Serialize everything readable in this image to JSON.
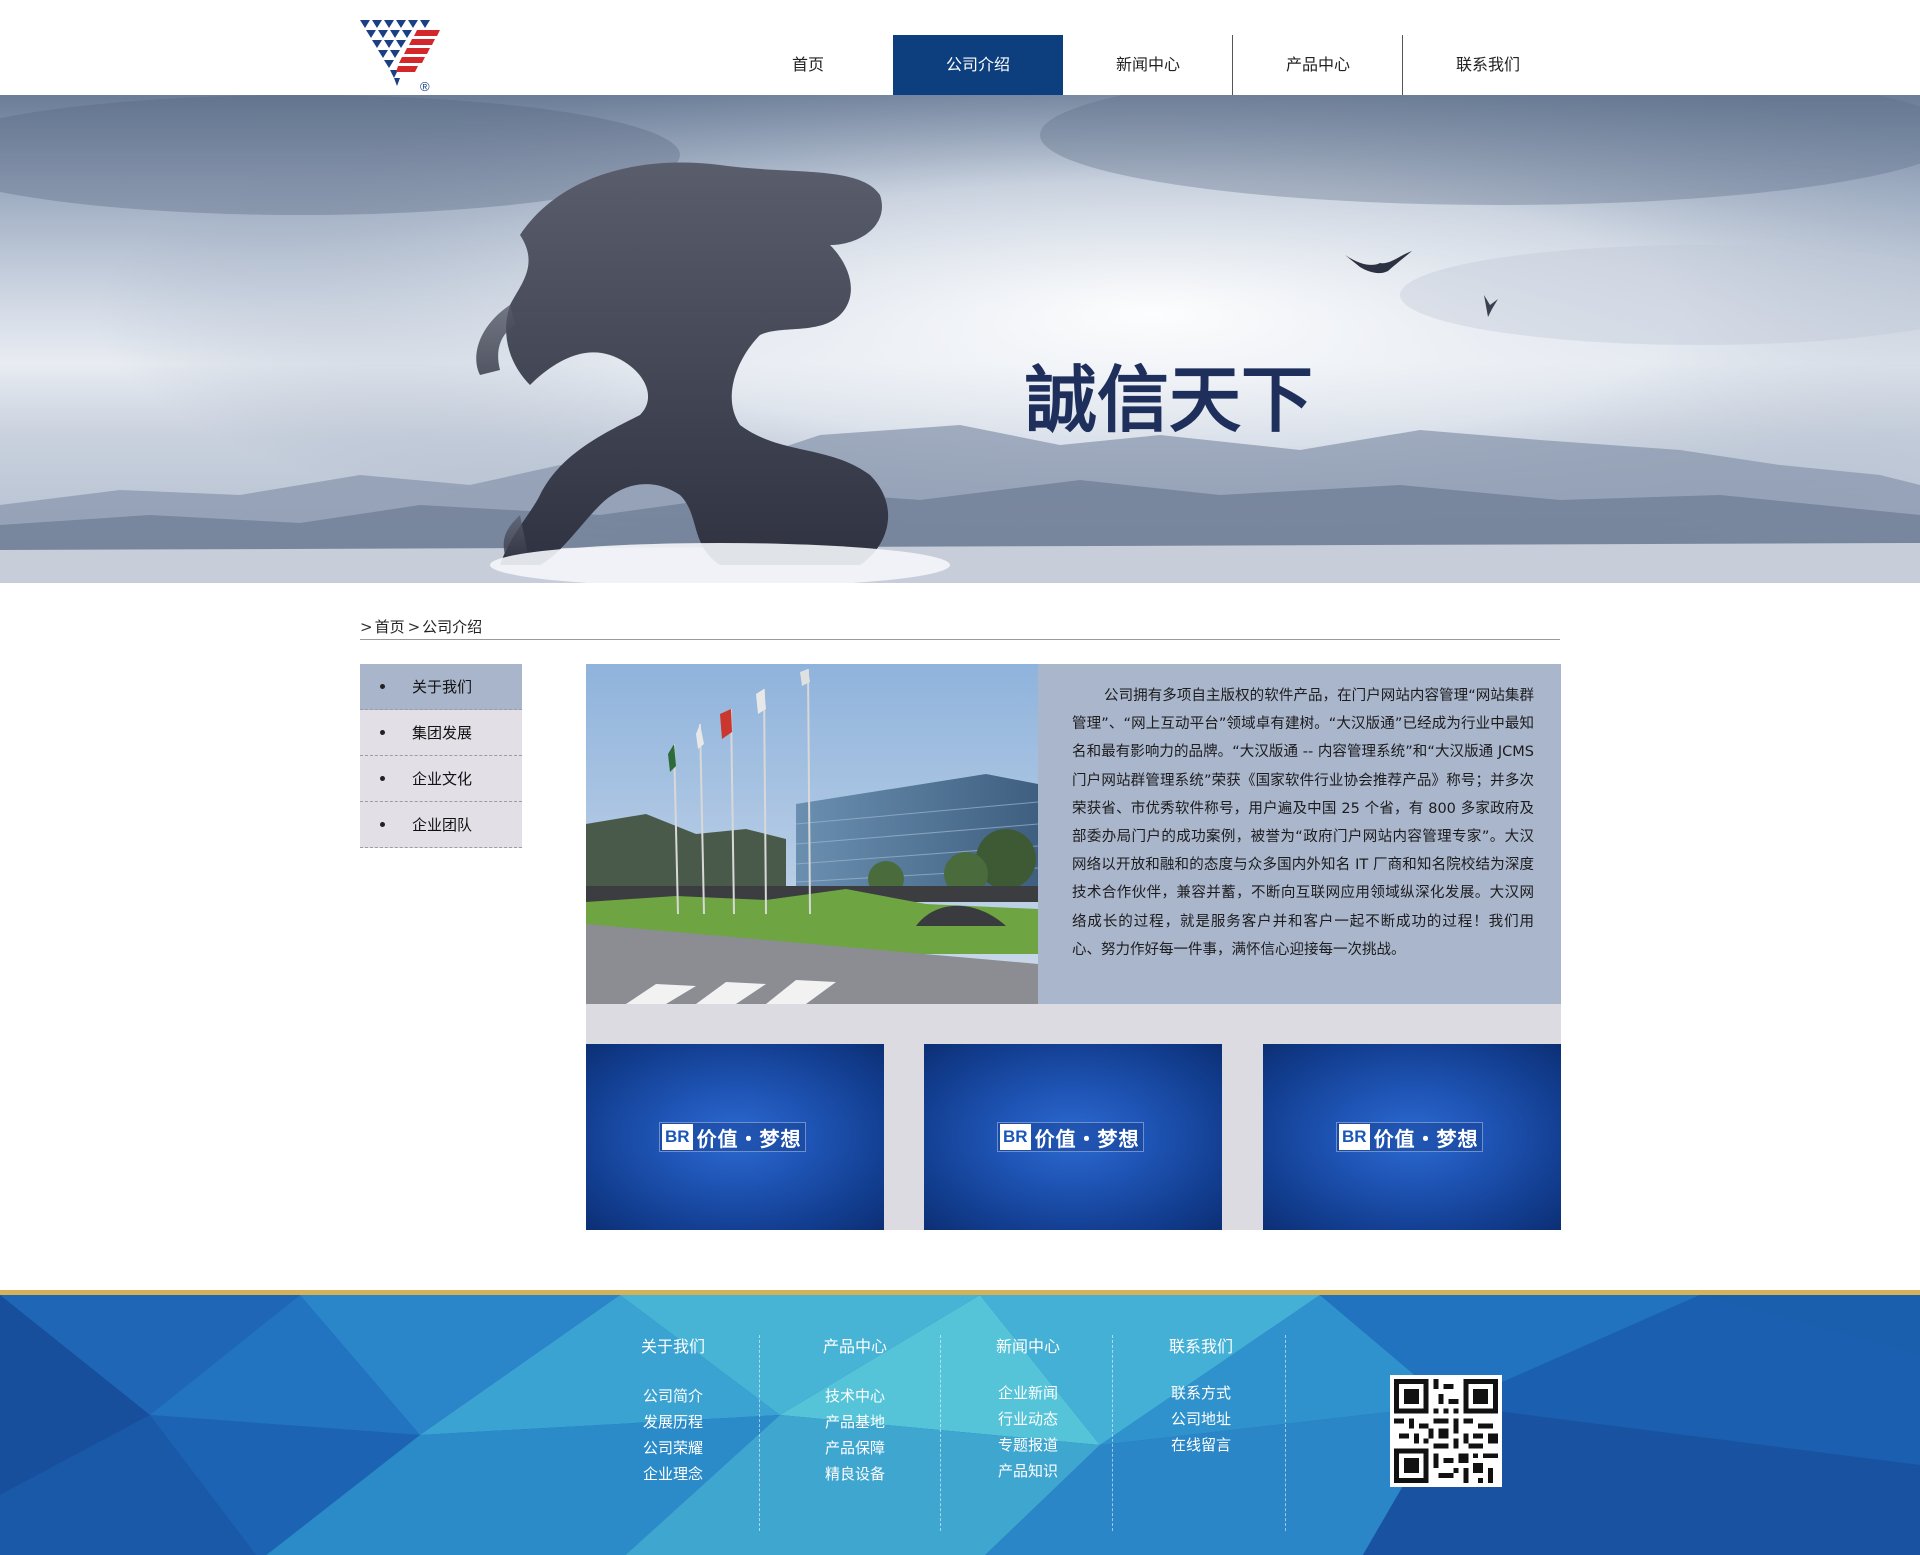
{
  "header": {
    "logo_icon": "triangle-stripes-logo-icon",
    "logo_mark": "®",
    "nav": [
      {
        "label": "首页",
        "active": false
      },
      {
        "label": "公司介绍",
        "active": true
      },
      {
        "label": "新闻中心",
        "active": false
      },
      {
        "label": "产品中心",
        "active": false
      },
      {
        "label": "联系我们",
        "active": false
      }
    ],
    "accent_color": "#0d3f7e"
  },
  "banner": {
    "slogan": "誠信天下",
    "image": "dragon-statue-mountains-banner"
  },
  "breadcrumb": {
    "items": [
      "首页",
      "公司介绍"
    ],
    "separator_icon": "chevron-right-icon"
  },
  "sidebar": {
    "items": [
      {
        "label": "关于我们",
        "active": true
      },
      {
        "label": "集团发展",
        "active": false
      },
      {
        "label": "企业文化",
        "active": false
      },
      {
        "label": "企业团队",
        "active": false
      }
    ]
  },
  "intro": {
    "image": "company-building-flags-photo",
    "text": "公司拥有多项自主版权的软件产品，在门户网站内容管理“网站集群管理”、“网上互动平台”领域卓有建树。“大汉版通”已经成为行业中最知名和最有影响力的品牌。“大汉版通 -- 内容管理系统”和“大汉版通 JCMS 门户网站群管理系统”荣获《国家软件行业协会推荐产品》称号；并多次荣获省、市优秀软件称号，用户遍及中国 25 个省，有 800 多家政府及部委办局门户的成功案例，被誉为“政府门户网站内容管理专家”。大汉网络以开放和融和的态度与众多国内外知名 IT 厂商和知名院校结为深度技术合作伙伴，兼容并蓄，不断向互联网应用领域纵深化发展。大汉网络成长的过程，就是服务客户并和客户一起不断成功的过程！我们用心、努力作好每一件事，满怀信心迎接每一次挑战。"
  },
  "cards": [
    {
      "badge": "BR",
      "text": "价值・梦想"
    },
    {
      "badge": "BR",
      "text": "价值・梦想"
    },
    {
      "badge": "BR",
      "text": "价值・梦想"
    }
  ],
  "footer": {
    "border_color": "#d4b25a",
    "columns": [
      {
        "title": "关于我们",
        "links": [
          "公司简介",
          "发展历程",
          "公司荣耀",
          "企业理念"
        ]
      },
      {
        "title": "产品中心",
        "links": [
          "技术中心",
          "产品基地",
          "产品保障",
          "精良设备"
        ]
      },
      {
        "title": "新闻中心",
        "links": [
          "企业新闻",
          "行业动态",
          "专题报道",
          "产品知识"
        ]
      },
      {
        "title": "联系我们",
        "links": [
          "联系方式",
          "公司地址",
          "在线留言"
        ]
      }
    ],
    "qr_icon": "qr-code-icon"
  }
}
